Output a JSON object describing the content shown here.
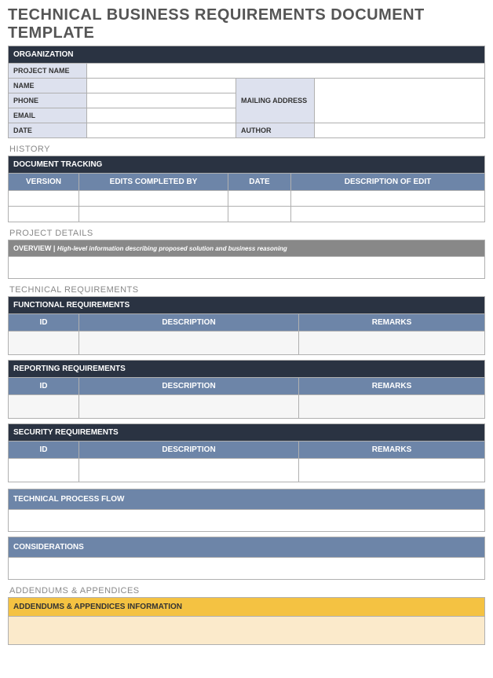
{
  "title": "TECHNICAL BUSINESS REQUIREMENTS DOCUMENT TEMPLATE",
  "org": {
    "header": "ORGANIZATION",
    "project_name": "PROJECT NAME",
    "name": "NAME",
    "phone": "PHONE",
    "email": "EMAIL",
    "date": "DATE",
    "mailing": "MAILING ADDRESS",
    "author": "AUTHOR"
  },
  "history": {
    "label": "HISTORY",
    "tracking": "DOCUMENT TRACKING",
    "cols": {
      "version": "VERSION",
      "edits": "EDITS COMPLETED BY",
      "date": "DATE",
      "desc": "DESCRIPTION OF EDIT"
    }
  },
  "details": {
    "label": "PROJECT DETAILS",
    "overview": "OVERVIEW  |",
    "hint": "High-level information describing proposed solution and business reasoning"
  },
  "tech": {
    "label": "TECHNICAL REQUIREMENTS",
    "functional": "FUNCTIONAL REQUIREMENTS",
    "reporting": "REPORTING REQUIREMENTS",
    "security": "SECURITY REQUIREMENTS",
    "cols": {
      "id": "ID",
      "desc": "DESCRIPTION",
      "remarks": "REMARKS"
    },
    "flow": "TECHNICAL PROCESS FLOW",
    "considerations": "CONSIDERATIONS"
  },
  "addendums": {
    "label": "ADDENDUMS & APPENDICES",
    "info": "ADDENDUMS & APPENDICES INFORMATION"
  }
}
